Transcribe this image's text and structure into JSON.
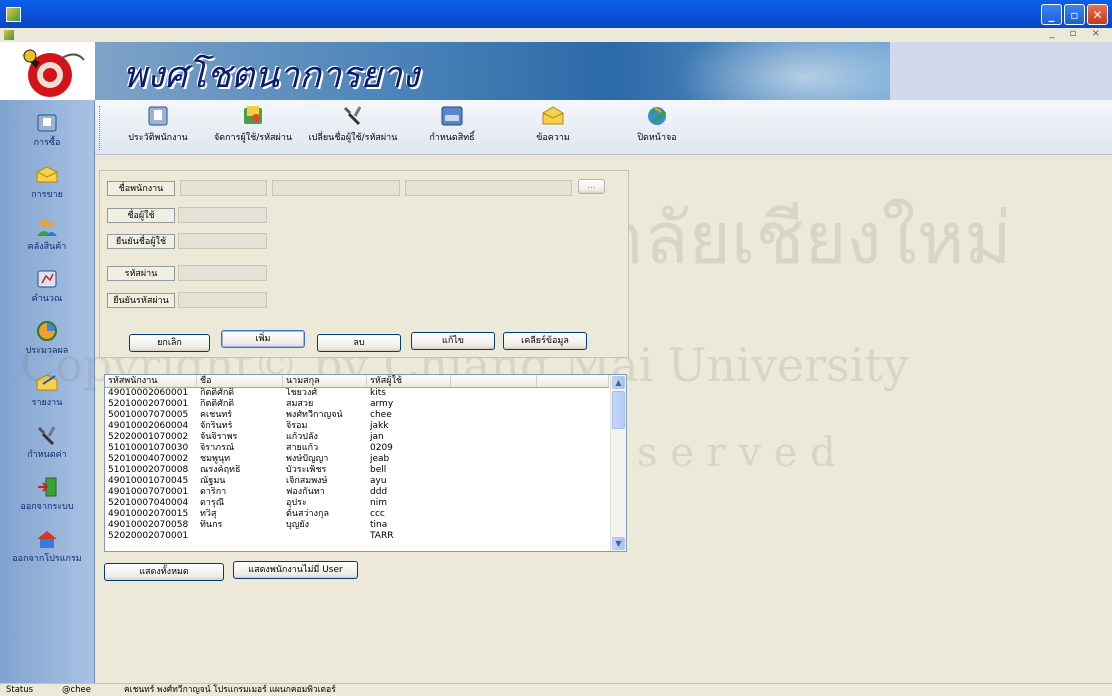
{
  "window": {
    "minimize": "_",
    "maximize": "▫",
    "close": "✕",
    "mdi_controls": "_ ▫ ×"
  },
  "banner": {
    "title": "พงศโชตนาการยาง"
  },
  "sidebar": {
    "items": [
      {
        "label": "การซื้อ",
        "icon": "folder-icon"
      },
      {
        "label": "การขาย",
        "icon": "envelope-icon"
      },
      {
        "label": "คลังสินค้า",
        "icon": "users-icon"
      },
      {
        "label": "คำนวณ",
        "icon": "calculator-icon"
      },
      {
        "label": "ประมวลผล",
        "icon": "chart-icon"
      },
      {
        "label": "รายงาน",
        "icon": "report-icon"
      },
      {
        "label": "กำหนดค่า",
        "icon": "tools-icon"
      },
      {
        "label": "ออกจากระบบ",
        "icon": "logout-icon"
      },
      {
        "label": "ออกจากโปรแกรม",
        "icon": "exit-program-icon"
      }
    ]
  },
  "toolbar": {
    "items": [
      {
        "label": "ประวัติพนักงาน",
        "icon": "employee-history-icon"
      },
      {
        "label": "จัดการผู้ใช้/รหัสผ่าน",
        "icon": "manage-user-icon"
      },
      {
        "label": "เปลี่ยนชื่อผู้ใช้/รหัสผ่าน",
        "icon": "change-password-icon"
      },
      {
        "label": "กำหนดสิทธิ์",
        "icon": "permission-icon"
      },
      {
        "label": "ข้อความ",
        "icon": "message-icon"
      },
      {
        "label": "ปิดหน้าจอ",
        "icon": "close-screen-icon"
      }
    ]
  },
  "form": {
    "employee_name_button": "ชื่อพนักงาน",
    "browse_button": "...",
    "username_label": "ชื่อผู้ใช้",
    "confirm_username_label": "ยืนยันชื่อผู้ใช้",
    "password_label": "รหัสผ่าน",
    "confirm_password_label": "ยืนยันรหัสผ่าน",
    "buttons": {
      "cancel": "ยกเลิก",
      "add": "เพิ่ม",
      "delete": "ลบ",
      "edit": "แก้ไข",
      "clear": "เคลียร์ข้อมูล"
    }
  },
  "table": {
    "columns": [
      "รหัสพนักงาน",
      "ชื่อ",
      "นามสกุล",
      "รหัสผู้ใช้"
    ],
    "rows": [
      [
        "49010002060001",
        "กิตติศักดิ์",
        "ไชยวงศ์",
        "kits"
      ],
      [
        "52010002070001",
        "กิตติศักดิ์",
        "สมสวย",
        "army"
      ],
      [
        "50010007070005",
        "คเชนทร์",
        "พงศ์ทวีกาญจน์",
        "chee"
      ],
      [
        "49010002060004",
        "จักรินทร์",
        "จิรอม",
        "jakk"
      ],
      [
        "52020001070002",
        "จันจิราพร",
        "แก้วปลั่ง",
        "jan"
      ],
      [
        "51010001070030",
        "จิราภรณ์",
        "สายแก้ว",
        "0209"
      ],
      [
        "52010004070002",
        "ชมพูนุท",
        "พงษ์ปัญญา",
        "jeab"
      ],
      [
        "51010002070008",
        "ณรงค์ฤทธิ์",
        "บัวระเพ็ชร",
        "bell"
      ],
      [
        "49010001070045",
        "ณัฐมน",
        "เจ็กสมพงษ์",
        "ayu"
      ],
      [
        "49010007070001",
        "ดาริกา",
        "ฟองกันทา",
        "ddd"
      ],
      [
        "52010007040004",
        "ดารุณี",
        "อุประ",
        "nim"
      ],
      [
        "49010002070015",
        "ทวิสุ",
        "ต้นสว่างกุล",
        "ccc"
      ],
      [
        "49010002070058",
        "ทินกร",
        "บุญยัง",
        "tina"
      ],
      [
        "52020002070001",
        "",
        "",
        "TARR"
      ]
    ]
  },
  "bottom_buttons": {
    "show_all": "แสดงทั้งหมด",
    "show_no_user": "แสดงพนักงานไม่มี User"
  },
  "statusbar": {
    "status": "Status",
    "user": "@chee",
    "info": "คเชนทร์ พงศ์ทวีกาญจน์ โปรแกรมเมอร์ แผนกคอมพิวเตอร์"
  },
  "watermark": {
    "line1": "ลิขสิทธิ์มหาวิทยาลัยเชียงใหม่",
    "line2": "Copyright© by Chiang Mai University",
    "line3": "A l l   r i g h t s   r e s e r v e d"
  }
}
